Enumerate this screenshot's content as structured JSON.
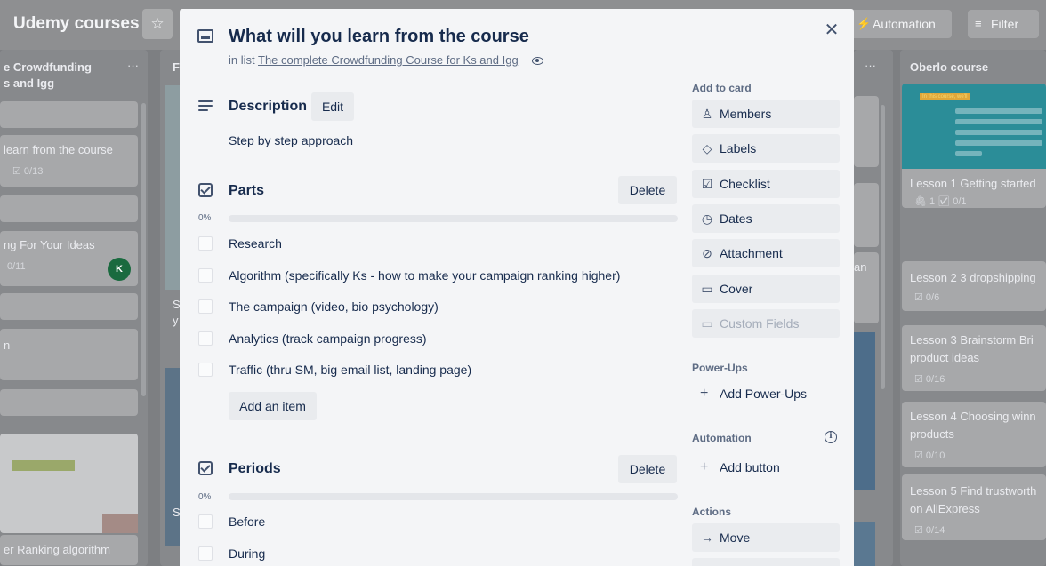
{
  "board": {
    "title": "Udemy courses",
    "automation_label": "Automation",
    "filter_label": "Filter",
    "columns": {
      "left": {
        "title_line1": "e Crowdfunding",
        "title_line2": "s and Igg",
        "cards": [
          {
            "text": "learn from the course",
            "badge": "☑ 0/13"
          },
          {
            "text": "ng For Your Ideas",
            "badge": "0/11",
            "avatar": "K"
          },
          {
            "text": "n"
          },
          {
            "text": "er Ranking algorithm"
          }
        ]
      },
      "second": {
        "title": "F",
        "snippets": [
          "S",
          "y",
          "S"
        ]
      },
      "right_peek": {
        "snippet": "an"
      },
      "oberlo": {
        "title": "Oberlo course",
        "thumb_tag": "In this course, we'll",
        "cards": [
          {
            "text": "Lesson 1 Getting started",
            "badge": "🖇 1   ☑ 0/1"
          },
          {
            "text": "Lesson 2 3 dropshipping",
            "badge": "☑ 0/6"
          },
          {
            "text_line1": "Lesson 3 Brainstorm Bri",
            "text_line2": "product ideas",
            "badge": "☑ 0/16"
          },
          {
            "text_line1": "Lesson 4 Choosing winn",
            "text_line2": "products",
            "badge": "☑ 0/10"
          },
          {
            "text_line1": "Lesson 5 Find trustworth",
            "text_line2": "on AliExpress",
            "badge": "☑ 0/14"
          }
        ]
      }
    }
  },
  "modal": {
    "title": "What will you learn from the course",
    "in_list_prefix": "in list",
    "list_name": "The complete Crowdfunding Course for Ks and Igg",
    "description": {
      "heading": "Description",
      "edit_label": "Edit",
      "text": "Step by step approach"
    },
    "checklists": [
      {
        "title": "Parts",
        "delete_label": "Delete",
        "percent_label": "0%",
        "percent": 0,
        "items": [
          "Research",
          "Algorithm (specifically Ks - how to make your campaign ranking higher)",
          "The campaign (video, bio psychology)",
          "Analytics (track campaign progress)",
          "Traffic (thru SM, big email list, landing page)"
        ],
        "add_item_label": "Add an item"
      },
      {
        "title": "Periods",
        "delete_label": "Delete",
        "percent_label": "0%",
        "percent": 0,
        "items": [
          "Before",
          "During"
        ]
      }
    ],
    "sidebar": {
      "add_to_card_label": "Add to card",
      "add_to_card": [
        {
          "label": "Members",
          "icon": "person-icon"
        },
        {
          "label": "Labels",
          "icon": "tag-icon"
        },
        {
          "label": "Checklist",
          "icon": "checklist-icon"
        },
        {
          "label": "Dates",
          "icon": "clock-icon"
        },
        {
          "label": "Attachment",
          "icon": "paperclip-icon"
        },
        {
          "label": "Cover",
          "icon": "cover-icon"
        },
        {
          "label": "Custom Fields",
          "icon": "custom-fields-icon",
          "disabled": true
        }
      ],
      "power_ups_label": "Power-Ups",
      "add_power_ups_label": "Add Power-Ups",
      "automation_label": "Automation",
      "add_button_label": "Add button",
      "actions_label": "Actions",
      "move_label": "Move"
    }
  },
  "colors": {
    "progress_fill": "#5aac44",
    "modal_bg": "#f4f5f7",
    "button_bg": "#eaecef",
    "text_primary": "#172b4d",
    "text_muted": "#5e6c84",
    "avatar_green": "#1a6a3f",
    "oberlo_thumb": "#2b8d98"
  }
}
